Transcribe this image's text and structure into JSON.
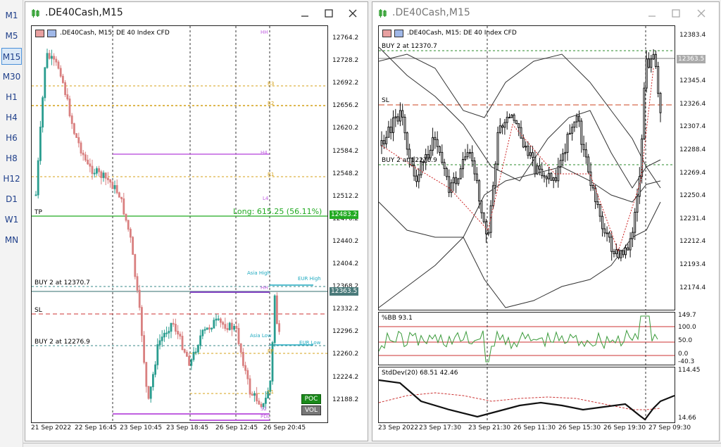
{
  "timeframes": {
    "items": [
      {
        "label": "M1"
      },
      {
        "label": "M5"
      },
      {
        "label": "M15"
      },
      {
        "label": "M30"
      },
      {
        "label": "H1"
      },
      {
        "label": "H4"
      },
      {
        "label": "H6"
      },
      {
        "label": "H8"
      },
      {
        "label": "H12"
      },
      {
        "label": "D1"
      },
      {
        "label": "W1"
      },
      {
        "label": "MN"
      }
    ],
    "active": "M15"
  },
  "left": {
    "title": ".DE40Cash,M15",
    "header": ".DE40Cash, M15:  DE 40 Index CFD",
    "price_ticks": [
      "12764.2",
      "12728.2",
      "12692.2",
      "12656.2",
      "12620.2",
      "12584.2",
      "12548.2",
      "12512.2",
      "12476.2",
      "12440.2",
      "12404.2",
      "12368.2",
      "12332.2",
      "12296.2",
      "12260.2",
      "12224.2",
      "12188.2"
    ],
    "time_ticks": [
      "21 Sep 2022",
      "22 Sep 16:45",
      "23 Sep 10:45",
      "23 Sep 18:45",
      "26 Sep 12:45",
      "26 Sep 20:45"
    ],
    "tp_label": "TP",
    "long_label": "Long: 615.25  (56.11%)",
    "tp_price": "12483.2",
    "buy1_label": "BUY 2 at 12370.7",
    "sl_label": "SL",
    "buy2_label": "BUY 2 at 12276.9",
    "bid_price": "12363.5",
    "asia_high": "Asia High",
    "asia_low": "Asia Low",
    "eur_high": "EUR High",
    "eur_low": "EUR Low",
    "poc_label": "POC",
    "vol_label": "VOL",
    "pivot_labels": {
      "r3": "R3",
      "r2": "R2",
      "r1": "R1",
      "pp": "PP",
      "s1": "S1",
      "s2": "S2",
      "hh": "HH",
      "h4": "H4",
      "l4": "L4",
      "pdl": "PDL"
    },
    "colors": {
      "tp": "#22aa22",
      "bid": "#5a8a8a",
      "sl": "#cc3333",
      "buy": "#3a8a8a",
      "pivot": "#d4a017",
      "magenta": "#c060e0",
      "cyan": "#20aac0"
    }
  },
  "right": {
    "title": ".DE40Cash,M15",
    "header": ".DE40Cash, M15:  DE 40 Index CFD",
    "price_ticks": [
      "12383.4",
      "12364.5",
      "12345.4",
      "12326.4",
      "12307.4",
      "12288.4",
      "12269.4",
      "12250.4",
      "12231.4",
      "12212.4",
      "12193.4",
      "12174.4"
    ],
    "time_ticks": [
      "23 Sep 2022",
      "23 Sep 17:30",
      "23 Sep 21:30",
      "26 Sep 11:30",
      "26 Sep 15:30",
      "26 Sep 19:30",
      "27 Sep 09:30"
    ],
    "buy1_label": "BUY 2 at 12370.7",
    "sl_label": "SL",
    "buy2_label": "BUY 2 at 12276.9",
    "bid_price": "12363.5",
    "bb_label": "%BB 93.1",
    "bb_ticks": [
      "149.7",
      "100.0",
      "50.0",
      "0.0",
      "-40.3"
    ],
    "std_label": "StdDev(20) 68.51 42.46",
    "std_ticks": [
      "114.45",
      "14.66"
    ]
  }
}
